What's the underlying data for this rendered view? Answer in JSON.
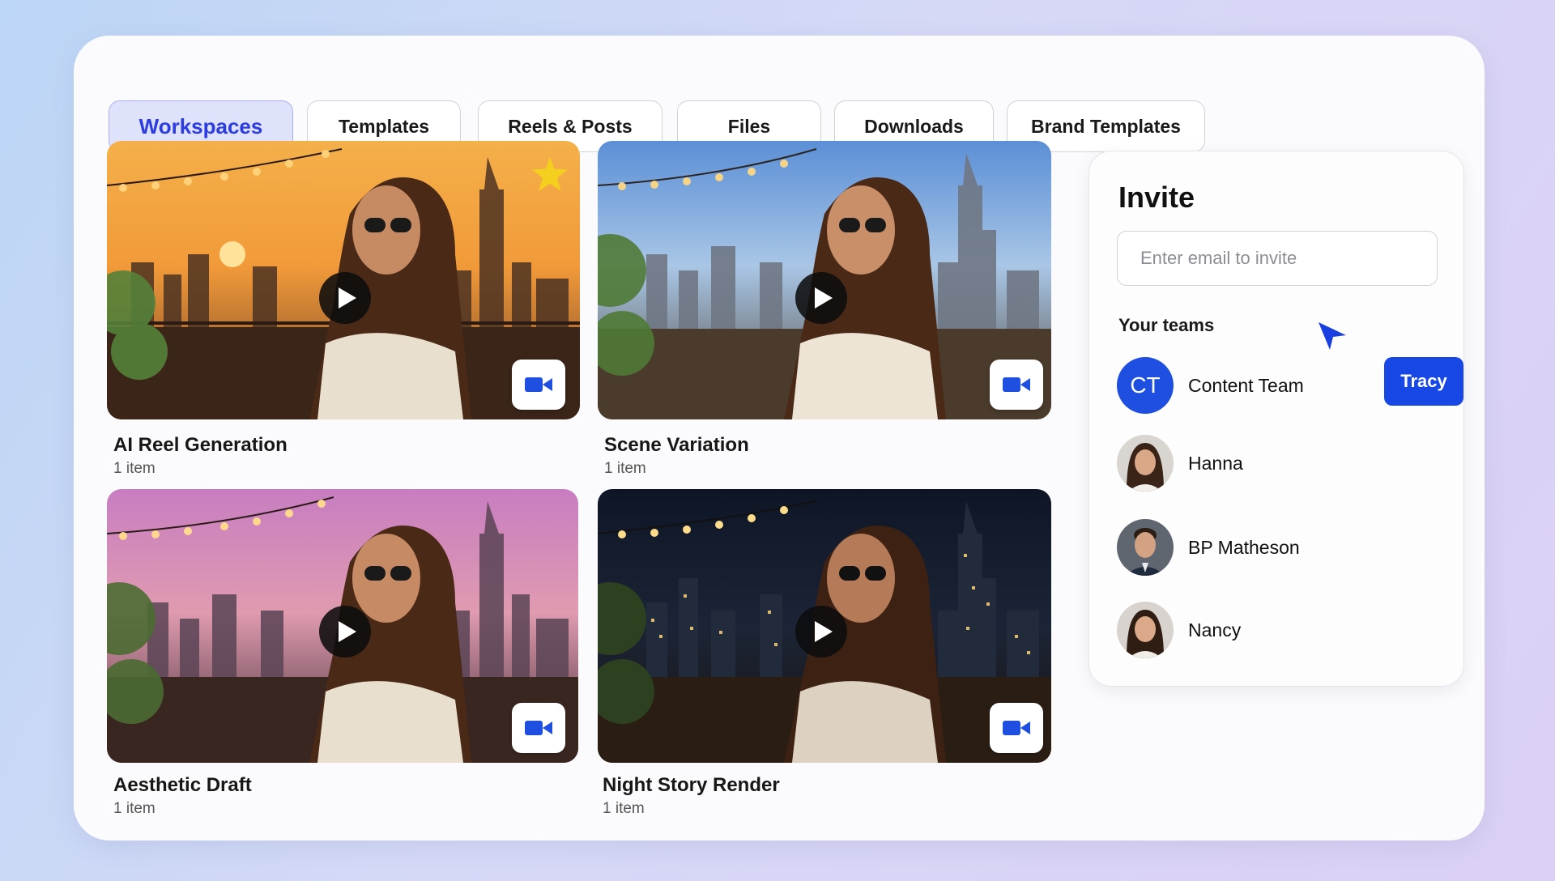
{
  "tabs": [
    {
      "label": "Workspaces",
      "active": true
    },
    {
      "label": "Templates",
      "active": false
    },
    {
      "label": "Reels & Posts",
      "active": false
    },
    {
      "label": "Files",
      "active": false
    },
    {
      "label": "Downloads",
      "active": false
    },
    {
      "label": "Brand Templates",
      "active": false
    }
  ],
  "workspaces": [
    {
      "title": "AI Reel Generation",
      "count": "1 item",
      "scene": "sunset",
      "favorite": true
    },
    {
      "title": "Scene Variation",
      "count": "1 item",
      "scene": "day",
      "favorite": false
    },
    {
      "title": "Aesthetic Draft",
      "count": "1 item",
      "scene": "dusk",
      "favorite": false
    },
    {
      "title": "Night Story Render",
      "count": "1 item",
      "scene": "night",
      "favorite": false
    }
  ],
  "icons": {
    "play": "play-icon",
    "video": "video-camera-icon",
    "favorite": "star-icon",
    "cursor": "cursor-arrow-icon"
  },
  "invite": {
    "title": "Invite",
    "email_placeholder": "Enter email to invite",
    "email_value": "",
    "teams_label": "Your teams",
    "members": [
      {
        "name": "Content Team",
        "initials": "CT",
        "action_label": "Tracy"
      },
      {
        "name": "Hanna"
      },
      {
        "name": "BP Matheson"
      },
      {
        "name": "Nancy"
      }
    ]
  },
  "colors": {
    "accent": "#1748e6",
    "active_tab_bg": "#dfe2fb",
    "active_tab_text": "#2b3de0",
    "favorite_star": "#f5cf1d"
  }
}
